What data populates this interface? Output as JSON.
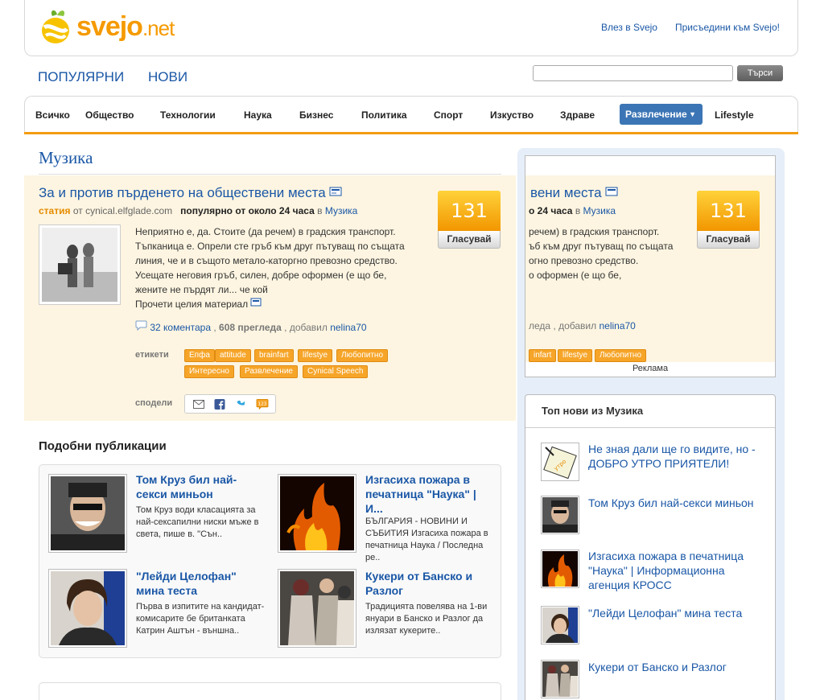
{
  "brand": {
    "logo": "svejo",
    "tld": ".net"
  },
  "header": {
    "login": "Влез в Svejo",
    "join": "Присъедини към Svejo!"
  },
  "topnav": {
    "popular": "ПОПУЛЯРНИ",
    "new": "НОВИ"
  },
  "search": {
    "placeholder": "",
    "button": "Търси"
  },
  "categories": [
    "Всичко",
    "Общество",
    "Технологии",
    "Наука",
    "Бизнес",
    "Политика",
    "Спорт",
    "Изкуство",
    "Здраве"
  ],
  "active_category": "Развлечение",
  "extra_category": "Lifestyle",
  "section_title": "Музика",
  "story": {
    "title": "За и против пърденето на обществени места",
    "type": "статия",
    "source": "от cynical.elfglade.com",
    "popular": "популярно от около 24 часа",
    "in": "в",
    "category": "Музика",
    "text": "Неприятно е, да. Стоите (да речем) в градския транспорт. Тъпканица е. Опрели сте гръб към друг пътуващ по същата линия, че и в същото метало-каторгно превозно средство. Усещате неговия гръб, силен, добре оформен (е що бе, жените не пърдят ли... че кой",
    "read_more": "Прочети целия материал",
    "comments": "32 коментара",
    "views": "608 прегледа",
    "added_by": "добавил",
    "author": "nelina70",
    "votes": "131",
    "vote_label": "Гласувай",
    "tags_label": "етикети",
    "tags": [
      "Епфа",
      "attitude",
      "brainfart",
      "lifestye",
      "Любопитно",
      "Интересно",
      "Развлечение",
      "Cynical Speech"
    ],
    "share_label": "сподели"
  },
  "ad": {
    "title_fragment": "вени места",
    "meta_fragment": "о 24 часа",
    "text_lines": [
      "речем) в градския транспорт.",
      "ъб към друг пътуващ по същата",
      "огно превозно средство.",
      "о оформен (е що бе,"
    ],
    "stats_fragment": "леда ,  добавил",
    "tags_fragment": [
      "infart",
      "lifestye",
      "Любопитно"
    ],
    "label": "Реклама"
  },
  "similar": {
    "title": "Подобни публикации",
    "items": [
      {
        "title": "Том Круз бил най-секси миньон",
        "text": "Том Круз води класацията за най-сексапилни ниски мъже в света, пише в. \"Сън.."
      },
      {
        "title": "Изгасиха пожара в печатница \"Наука\" | И...",
        "text": "БЪЛГАРИЯ - НОВИНИ И СЪБИТИЯ Изгасиха пожара в печатница Наука / Последна ре.."
      },
      {
        "title": "\"Лейди Целофан\" мина теста",
        "text": "Първа в изпитите на кандидат-комисарите бе британката Катрин Аштън - външна.."
      },
      {
        "title": "Кукери от Банско и Разлог",
        "text": "Традицията повелява на 1-ви януари в Банско и Разлог да излязат кукерите.."
      }
    ]
  },
  "topnew": {
    "title": "Топ нови из Музика",
    "items": [
      "Не зная дали ще го видите, но - ДОБРО УТРО ПРИЯТЕЛИ!",
      "Том Круз бил най-секси миньон",
      "Изгасиха пожара в печатница \"Наука\" | Информационна агенция КРОСС",
      "\"Лейди Целофан\" мина теста",
      "Кукери от Банско и Разлог"
    ]
  }
}
